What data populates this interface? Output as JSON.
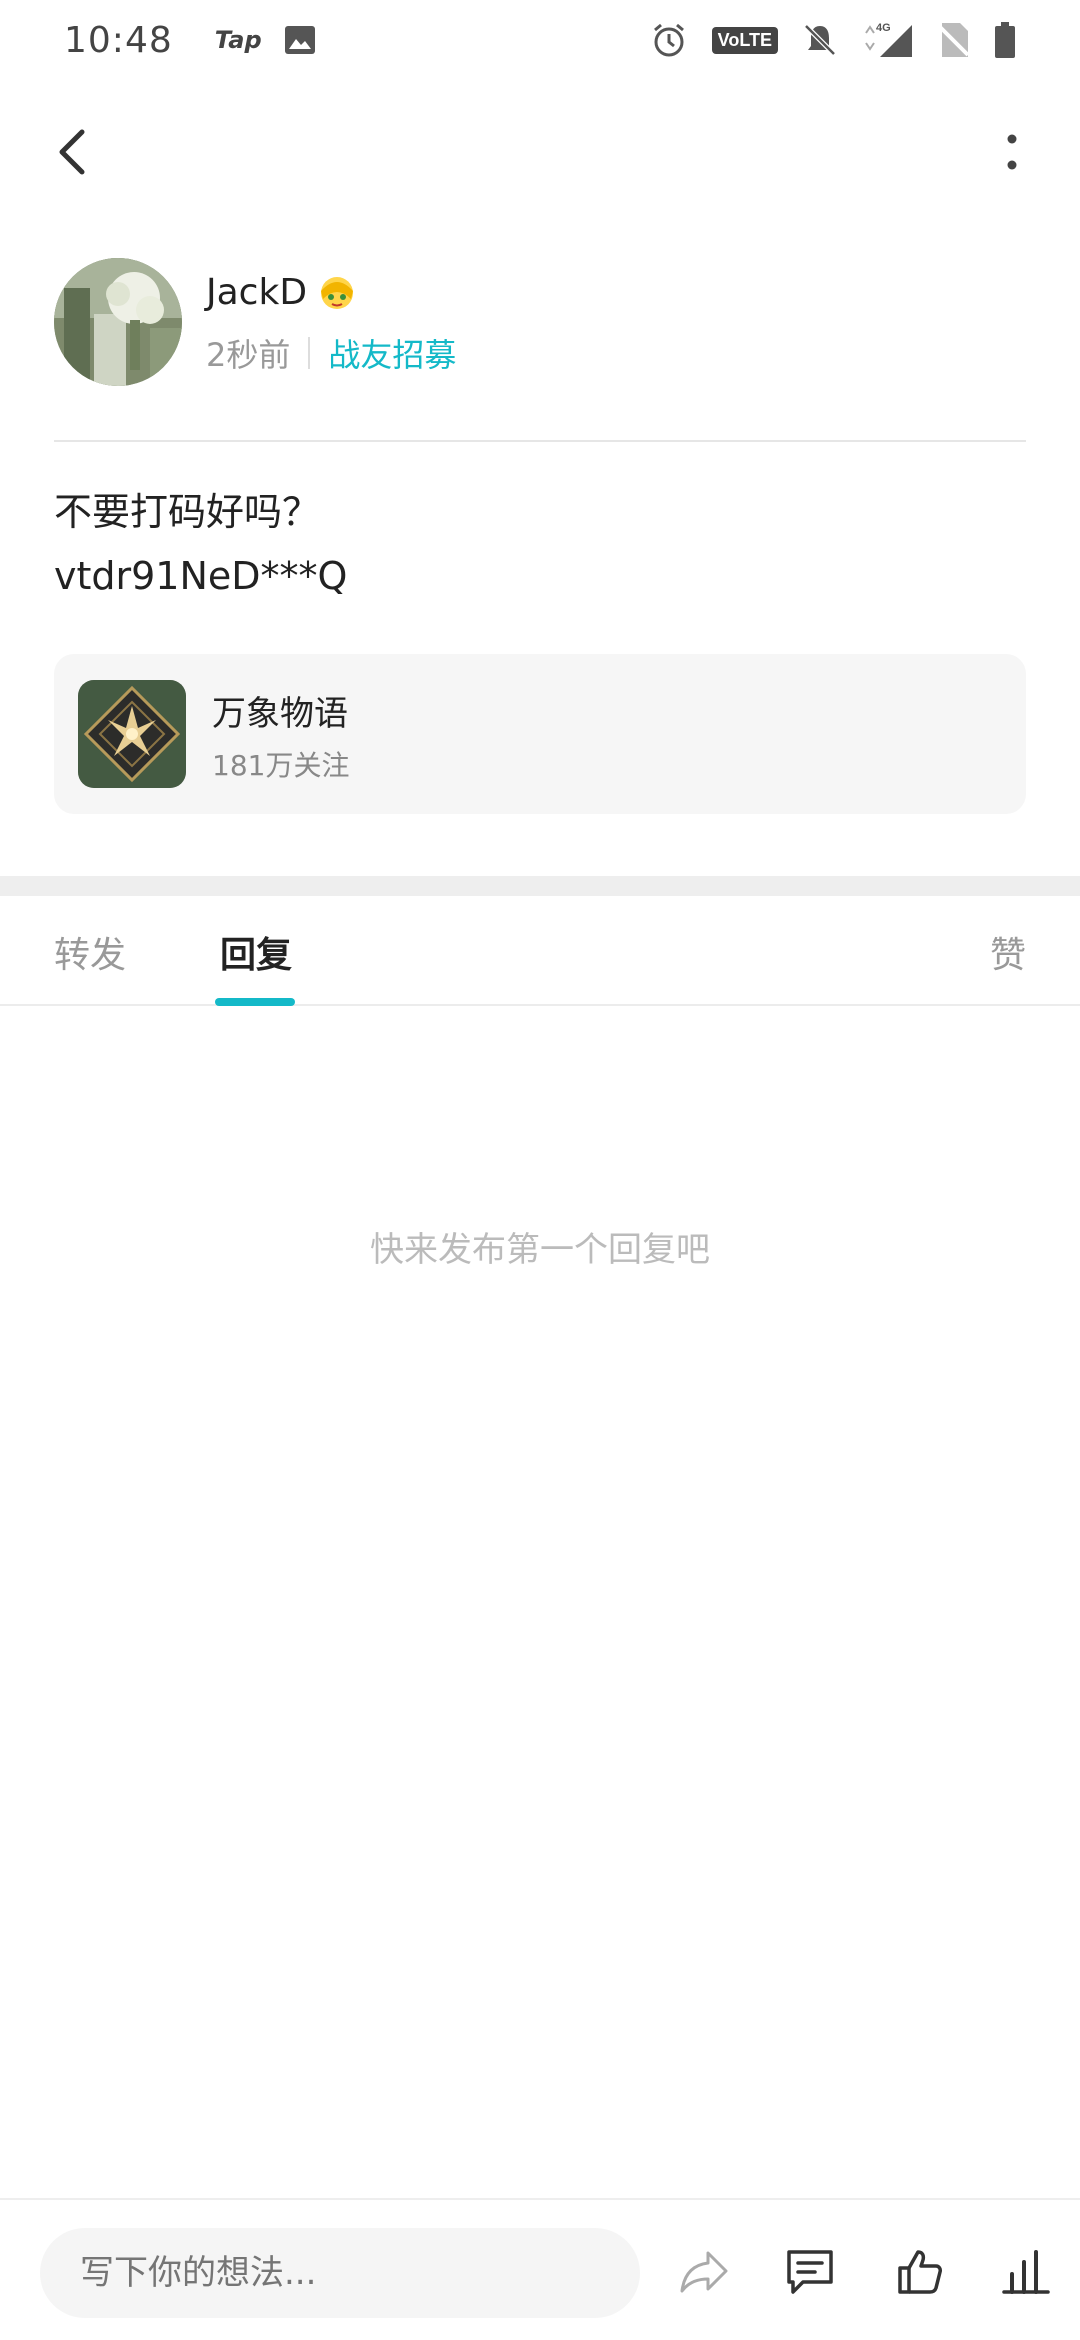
{
  "status_bar": {
    "time": "10:48",
    "app_label": "Tap",
    "volte_label": "VoLTE",
    "network_label": "4G"
  },
  "author": {
    "name": "JackD",
    "time_ago": "2秒前",
    "category": "战友招募"
  },
  "post": {
    "line1": "不要打码好吗？",
    "line2": "vtdr91NeD***Q"
  },
  "game_card": {
    "name": "万象物语",
    "followers": "181万关注"
  },
  "tabs": [
    {
      "label": "转发"
    },
    {
      "label": "回复"
    },
    {
      "label": "赞"
    }
  ],
  "active_tab": "回复",
  "empty_state": "快来发布第一个回复吧",
  "bottom_bar": {
    "input_placeholder": "写下你的想法..."
  },
  "colors": {
    "accent": "#14b9c8",
    "text_primary": "#222222",
    "text_secondary": "#999999"
  }
}
